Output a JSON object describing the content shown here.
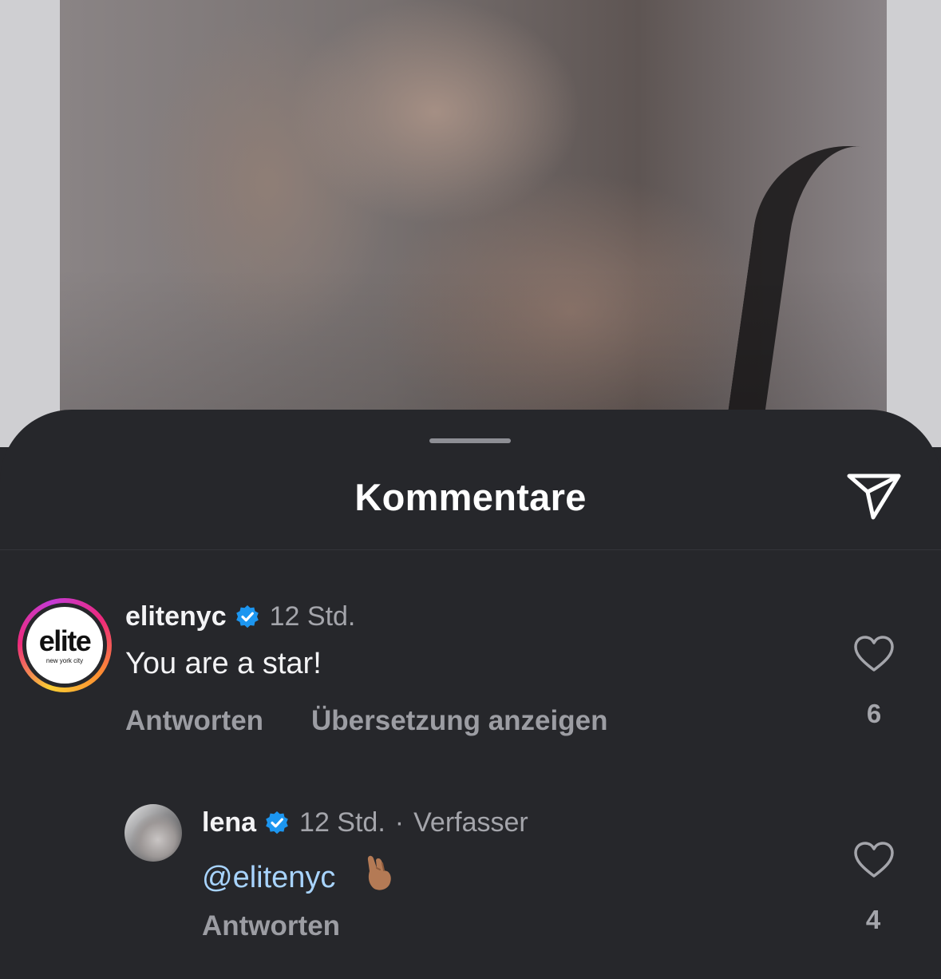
{
  "sheet": {
    "title": "Kommentare",
    "share_icon": "paper-plane-icon"
  },
  "comments": [
    {
      "username": "elitenyc",
      "verified": true,
      "avatar": {
        "type": "logo",
        "logo_text": "elite",
        "logo_subtext": "new york city",
        "story_ring": true
      },
      "time": "12 Std.",
      "text": "You are a star!",
      "reply_label": "Antworten",
      "translate_label": "Übersetzung anzeigen",
      "like_count": "6"
    },
    {
      "username": "lena",
      "verified": true,
      "avatar": {
        "type": "photo"
      },
      "time": "12 Std.",
      "separator": "·",
      "author_badge": "Verfasser",
      "mention": "@elitenyc",
      "emoji": "crossed-fingers-emoji",
      "reply_label": "Antworten",
      "like_count": "4"
    }
  ],
  "colors": {
    "sheet_bg": "#26272b",
    "verified_blue": "#1c96f0",
    "mention": "#a8d4ff",
    "secondary_text": "#a4a5ab"
  }
}
